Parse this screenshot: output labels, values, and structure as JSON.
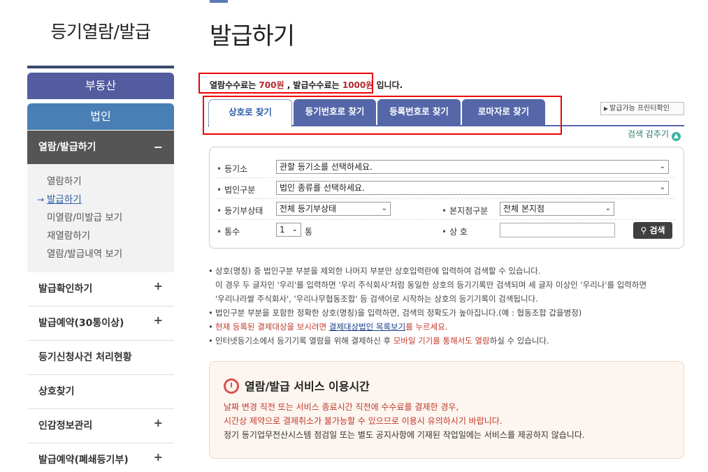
{
  "sidebar": {
    "title": "등기열람/발급",
    "btn_realestate": "부동산",
    "btn_corp": "법인",
    "active_menu": "열람/발급하기",
    "active_menu_icon": "minus-icon",
    "submenu": [
      "열람하기",
      "발급하기",
      "미열람/미발급 보기",
      "재열람하기",
      "열람/발급내역 보기"
    ],
    "submenu_active_index": 1,
    "items": [
      {
        "label": "발급확인하기",
        "has_plus": true
      },
      {
        "label": "발급예약(30통이상)",
        "has_plus": true
      },
      {
        "label": "등기신청사건 처리현황",
        "has_plus": false
      },
      {
        "label": "상호찾기",
        "has_plus": false
      },
      {
        "label": "인감정보관리",
        "has_plus": true
      },
      {
        "label": "발급예약(폐쇄등기부)",
        "has_plus": true
      }
    ]
  },
  "main": {
    "title": "발급하기",
    "fee": {
      "p1": "열람수수료는 ",
      "view_fee": "700원",
      "p2": " , 발급수수료는 ",
      "issue_fee": "1000원",
      "p3": " 입니다."
    },
    "tabs": [
      "상호로 찾기",
      "등기번호로 찾기",
      "등록번호로 찾기",
      "로마자로 찾기"
    ],
    "active_tab": 0,
    "printer_button": "발급가능 프린터확인",
    "search_toggle": "검색 감추기",
    "form": {
      "registry_label": "등기소",
      "registry_value": "관할 등기소를 선택하세요.",
      "corp_type_label": "법인구분",
      "corp_type_value": "법인 종류를 선택하세요.",
      "status_label": "등기부상태",
      "status_value": "전체 등기부상태",
      "branch_label": "본지점구분",
      "branch_value": "전체 본지점",
      "count_label": "통수",
      "count_value": "1",
      "count_unit": "통",
      "name_label": "상 호",
      "name_value": "",
      "search_button": "검색"
    },
    "notes": {
      "n1": "상호(명칭) 중 법인구분 부분을 제외한 나머지 부분만 상호입력란에 입력하여 검색할 수 있습니다.",
      "n1b": "이 경우 두 글자인 '우리'를 입력하면 '우리 주식회사'처럼 동일한 상호의 등기기록만 검색되며 세 글자 이상인 '우리나'를 입력하면",
      "n1c": "'우리나라쌀 주식회사', '우리나무협동조합' 등 검색어로 시작하는 상호의 등기기록이 검색됩니다.",
      "n2": "법인구분 부분을 포함한 정확한 상호(명칭)을 입력하면, 검색의 정확도가 높아집니다.(예 : 협동조합 갑을병정)",
      "n3a": "현재 등록된 결제대상을 보시려면 ",
      "n3link": "결제대상법인 목록보기",
      "n3b": "를 누르세요.",
      "n4a": "인터넷등기소에서 등기기록 열람을 위해 결제하신 후 ",
      "n4red": "모바일 기기를 통해서도 열람",
      "n4b": "하실 수 있습니다."
    },
    "service": {
      "title": "열람/발급 서비스 이용시간",
      "line1": "날짜 변경 직전 또는 서비스 종료시간 직전에 수수료를 결제한 경우,",
      "line2": "시간상 제약으로 결제취소가 불가능할 수 있으므로 이용시 유의하시기 바랍니다.",
      "line3": "정기 등기업무전산시스템 점검일 또는 별도 공지사항에 기재된 작업일에는 서비스를 제공하지 않습니다."
    }
  },
  "colors": {
    "realestate": "#525c9f",
    "corp": "#4a7fb5",
    "tab": "#5567a9",
    "highlight_box": "#ee0000",
    "fee_red": "#b2292e"
  }
}
